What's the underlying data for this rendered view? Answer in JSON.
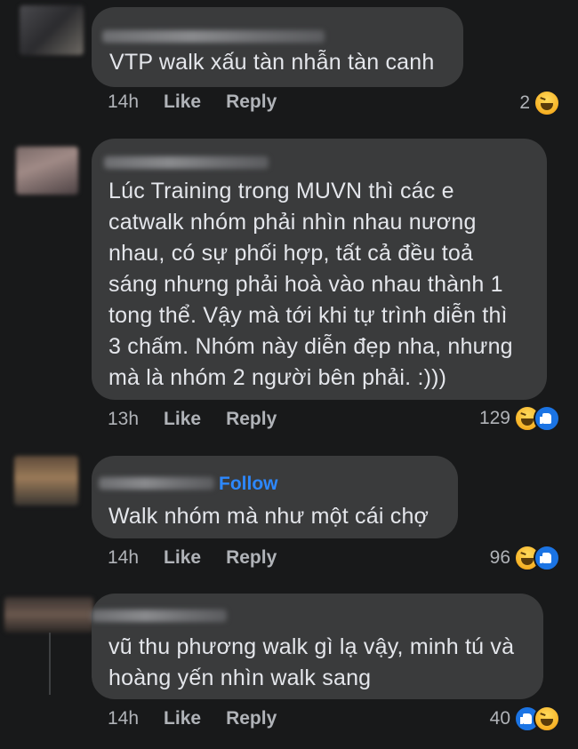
{
  "comments": [
    {
      "text": "VTP walk xấu tàn nhẫn tàn canh",
      "time": "14h",
      "like": "Like",
      "reply": "Reply",
      "reaction_count": "2",
      "reactions": [
        "haha"
      ]
    },
    {
      "text": "Lúc Training trong MUVN thì các e\ncatwalk nhóm phải nhìn nhau nương\nnhau, có sự phối hợp, tất cả đều toả\nsáng nhưng phải hoà vào nhau thành 1\ntong thể. Vậy mà tới khi tự trình diễn thì\n3 chấm. Nhóm này diễn đẹp nha, nhưng\nmà là nhóm 2 người bên phải. :)))",
      "time": "13h",
      "like": "Like",
      "reply": "Reply",
      "reaction_count": "129",
      "reactions": [
        "haha",
        "like"
      ]
    },
    {
      "follow": "Follow",
      "text": "Walk nhóm mà như một cái chợ",
      "time": "14h",
      "like": "Like",
      "reply": "Reply",
      "reaction_count": "96",
      "reactions": [
        "haha",
        "like"
      ]
    },
    {
      "text": "vũ thu phương walk gì lạ vậy, minh tú và\nhoàng yến nhìn walk sang",
      "time": "14h",
      "like": "Like",
      "reply": "Reply",
      "reaction_count": "40",
      "reactions": [
        "like",
        "haha"
      ]
    }
  ],
  "colors": {
    "background": "#18191a",
    "bubble": "#3a3b3c",
    "text": "#e4e6eb",
    "meta": "#b0b3b8",
    "follow": "#2d88ff",
    "like_blue": "#1b74e4",
    "haha_yellow": "#f7b125"
  }
}
